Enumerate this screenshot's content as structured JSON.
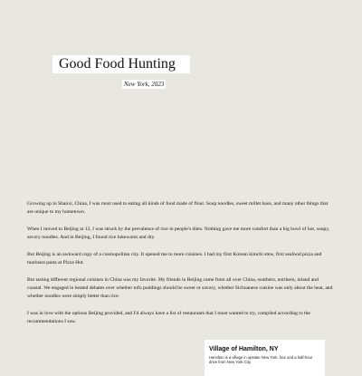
{
  "header": {
    "title": "Good Food Hunting",
    "subtitle": "New York, 2023"
  },
  "article": {
    "paragraphs": [
      "Growing up in Shanxi, China, I was most used to eating all kinds of food made of flour. Soup noodles, sweet millet baos, and many other things that are unique to my hometown.",
      "When I moved to Beijing at 12, I was struck by the prevalence of rice in people's diets. Nothing gave me more comfort than a big bowl of hot, soupy, savory noodles. And in Beijing, I found rice lukewarm and dry.",
      "But Beijing is an awkward copy of a cosmopolitan city. It opened me to more cuisines. I had my first Korean kimchi stew, first seafood pizza and marinara pasta at Pizza Hut.",
      "But tasting different regional cuisines in China was my favorite. My friends in Beijing came from all over China, southern, northern, inland and coastal. We engaged in heated debates over whether tofu puddings should be sweet or savory, whether Sichuanese cuisine was only about the heat, and whether noodles were simply better than rice.",
      "I was in love with the options Beijing provided, and I'd always have a list of restaurants that I most wanted to try, compiled according to the recommendations I saw."
    ]
  },
  "card": {
    "title": "Village of Hamilton, NY",
    "text": "Hamilton is a village in upstate New York, four and a half-hour drive from New York City."
  }
}
